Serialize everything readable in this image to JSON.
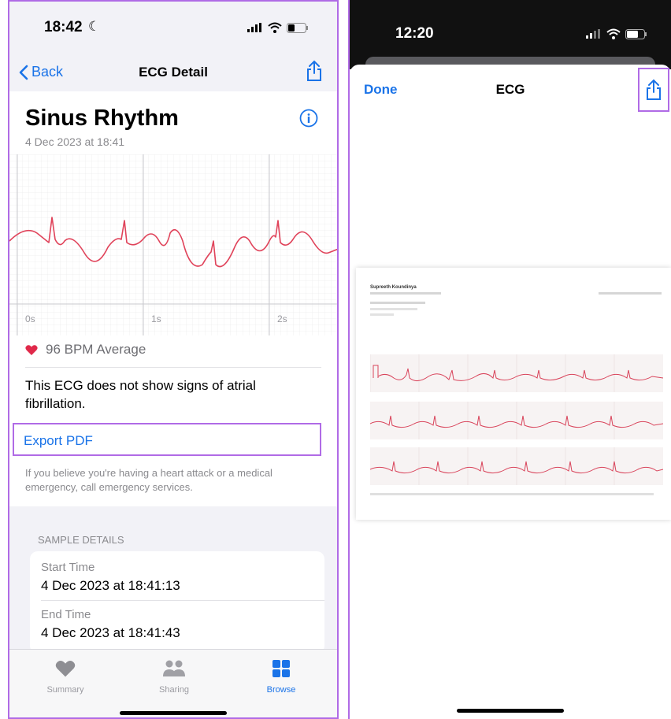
{
  "left": {
    "status_time": "18:42",
    "nav": {
      "back": "Back",
      "title": "ECG Detail",
      "share_icon": "share-icon"
    },
    "result": {
      "title": "Sinus Rhythm",
      "date": "4 Dec 2023 at 18:41"
    },
    "ticks": [
      "0s",
      "1s",
      "2s"
    ],
    "bpm": "96 BPM Average",
    "description": "This ECG does not show signs of atrial fibrillation.",
    "export": "Export PDF",
    "note": "If you believe you're having a heart attack or a medical emergency, call emergency services.",
    "sample": {
      "header": "SAMPLE DETAILS",
      "rows": [
        {
          "label": "Start Time",
          "value": "4 Dec 2023 at 18:41:13"
        },
        {
          "label": "End Time",
          "value": "4 Dec 2023 at 18:41:43"
        }
      ]
    },
    "tabs": [
      {
        "label": "Summary",
        "icon": "heart-icon"
      },
      {
        "label": "Sharing",
        "icon": "people-icon"
      },
      {
        "label": "Browse",
        "icon": "grid-icon"
      }
    ],
    "colors": {
      "accent": "#1a73e8",
      "ecg": "#e0435a",
      "highlight": "#b06be6"
    }
  },
  "right": {
    "status_time": "12:20",
    "done": "Done",
    "title": "ECG",
    "pdf": {
      "name": "Supreeth Koundinya"
    }
  }
}
